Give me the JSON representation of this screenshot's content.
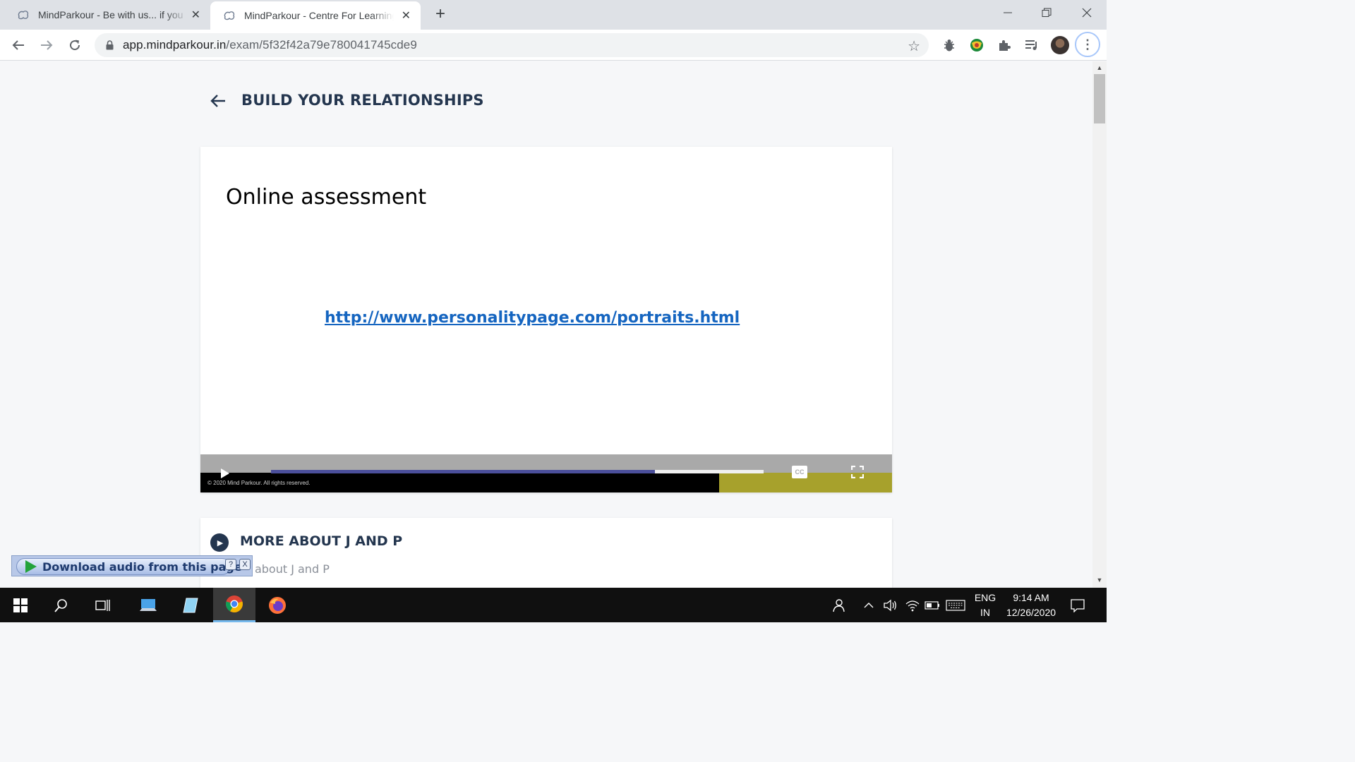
{
  "browser": {
    "tabs": [
      {
        "title": "MindParkour - Be with us... if you",
        "active": false
      },
      {
        "title": "MindParkour - Centre For Learning",
        "active": true
      }
    ],
    "url_host": "app.mindparkour.in",
    "url_path": "/exam/5f32f42a79e780041745cde9"
  },
  "page": {
    "title": "BUILD YOUR RELATIONSHIPS"
  },
  "video": {
    "slide_heading": "Online assessment",
    "slide_link": "http://www.personalitypage.com/portraits.html",
    "copyright": "© 2020 Mind Parkour. All rights reserved.",
    "cc_label": "CC",
    "progress_fraction": 0.78
  },
  "section": {
    "title": "MORE ABOUT J AND P",
    "subtitle": "ore about J and P"
  },
  "audio_widget": {
    "label": "Download audio from this page",
    "help": "?",
    "close": "X"
  },
  "taskbar": {
    "lang_line1": "ENG",
    "lang_line2": "IN",
    "time": "9:14 AM",
    "date": "12/26/2020"
  },
  "colors": {
    "heading": "#24364f",
    "link": "#1565c0",
    "seek_fill": "#4b4f9b",
    "olive_bar": "#a7a12c"
  }
}
